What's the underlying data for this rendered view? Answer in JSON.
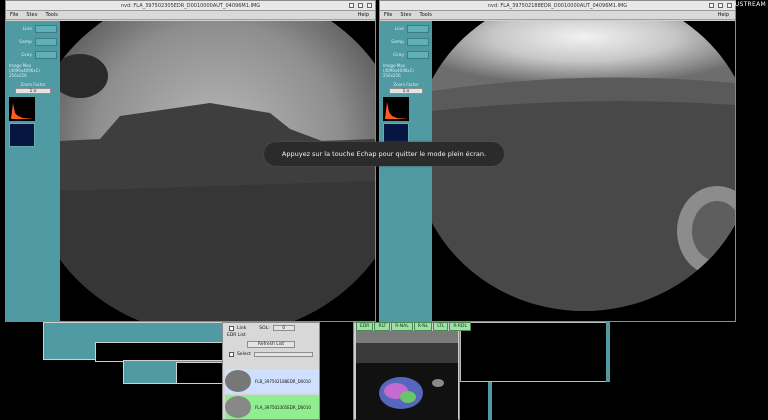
{
  "watermark": "USTREAM",
  "toast": "Appuyez sur la touche Echap pour quitter le mode plein écran.",
  "left_window": {
    "title": "nvd: FLA_397502305EDR_D0010000AUT_04096M1.IMG",
    "menu": [
      "File",
      "Stev",
      "Tools"
    ],
    "help": "Help",
    "fields": [
      "Line",
      "Samp",
      "Gray"
    ],
    "info": [
      "Image Max (4096x4096x1)",
      "256x256"
    ],
    "zoom_label": "Zoom Factor",
    "zoom_value": "1:x"
  },
  "right_window": {
    "title": "nvd: FLA_397502188EDR_D0010000AUT_04096M1.IMG",
    "menu": [
      "File",
      "Stev",
      "Tools"
    ],
    "help": "Help",
    "fields": [
      "Line",
      "Samp",
      "Gray"
    ],
    "info": [
      "Image Max (4096x4096x1)",
      "256x256"
    ],
    "zoom_label": "Zoom Factor",
    "zoom_value": "1:x"
  },
  "bottom_panel": {
    "link_label": "Link",
    "sol_label": "SOL:",
    "sol_value": "0",
    "edr_list": "EDR List",
    "refresh": "Refresh List",
    "select": "Select",
    "items": [
      "FLB_397502188EDR_D0010",
      "FLA_397502305EDR_D0010"
    ]
  },
  "tabs": [
    "EDR",
    "RLT",
    "R-NAL",
    "R-NL",
    "LTL",
    "R-RDL"
  ]
}
